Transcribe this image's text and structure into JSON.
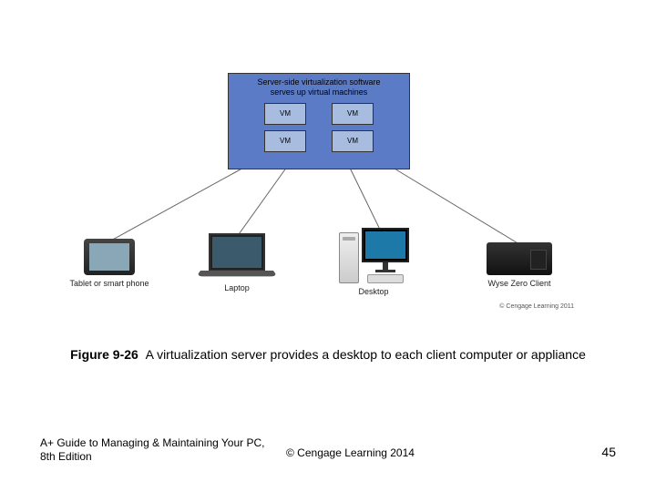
{
  "server": {
    "title_line1": "Server-side virtualization software",
    "title_line2": "serves up virtual machines",
    "vm_label": "VM"
  },
  "clients": [
    {
      "label": "Tablet or smart phone"
    },
    {
      "label": "Laptop"
    },
    {
      "label": "Desktop"
    },
    {
      "label": "Wyse Zero Client"
    }
  ],
  "diagram_attrib": "© Cengage Learning 2011",
  "caption": {
    "fig_label": "Figure 9-26",
    "text": "A virtualization server provides a desktop to each client computer or appliance"
  },
  "footer": {
    "book": "A+ Guide to Managing & Maintaining Your PC, 8th Edition",
    "copyright": "© Cengage Learning 2014",
    "page": "45"
  }
}
